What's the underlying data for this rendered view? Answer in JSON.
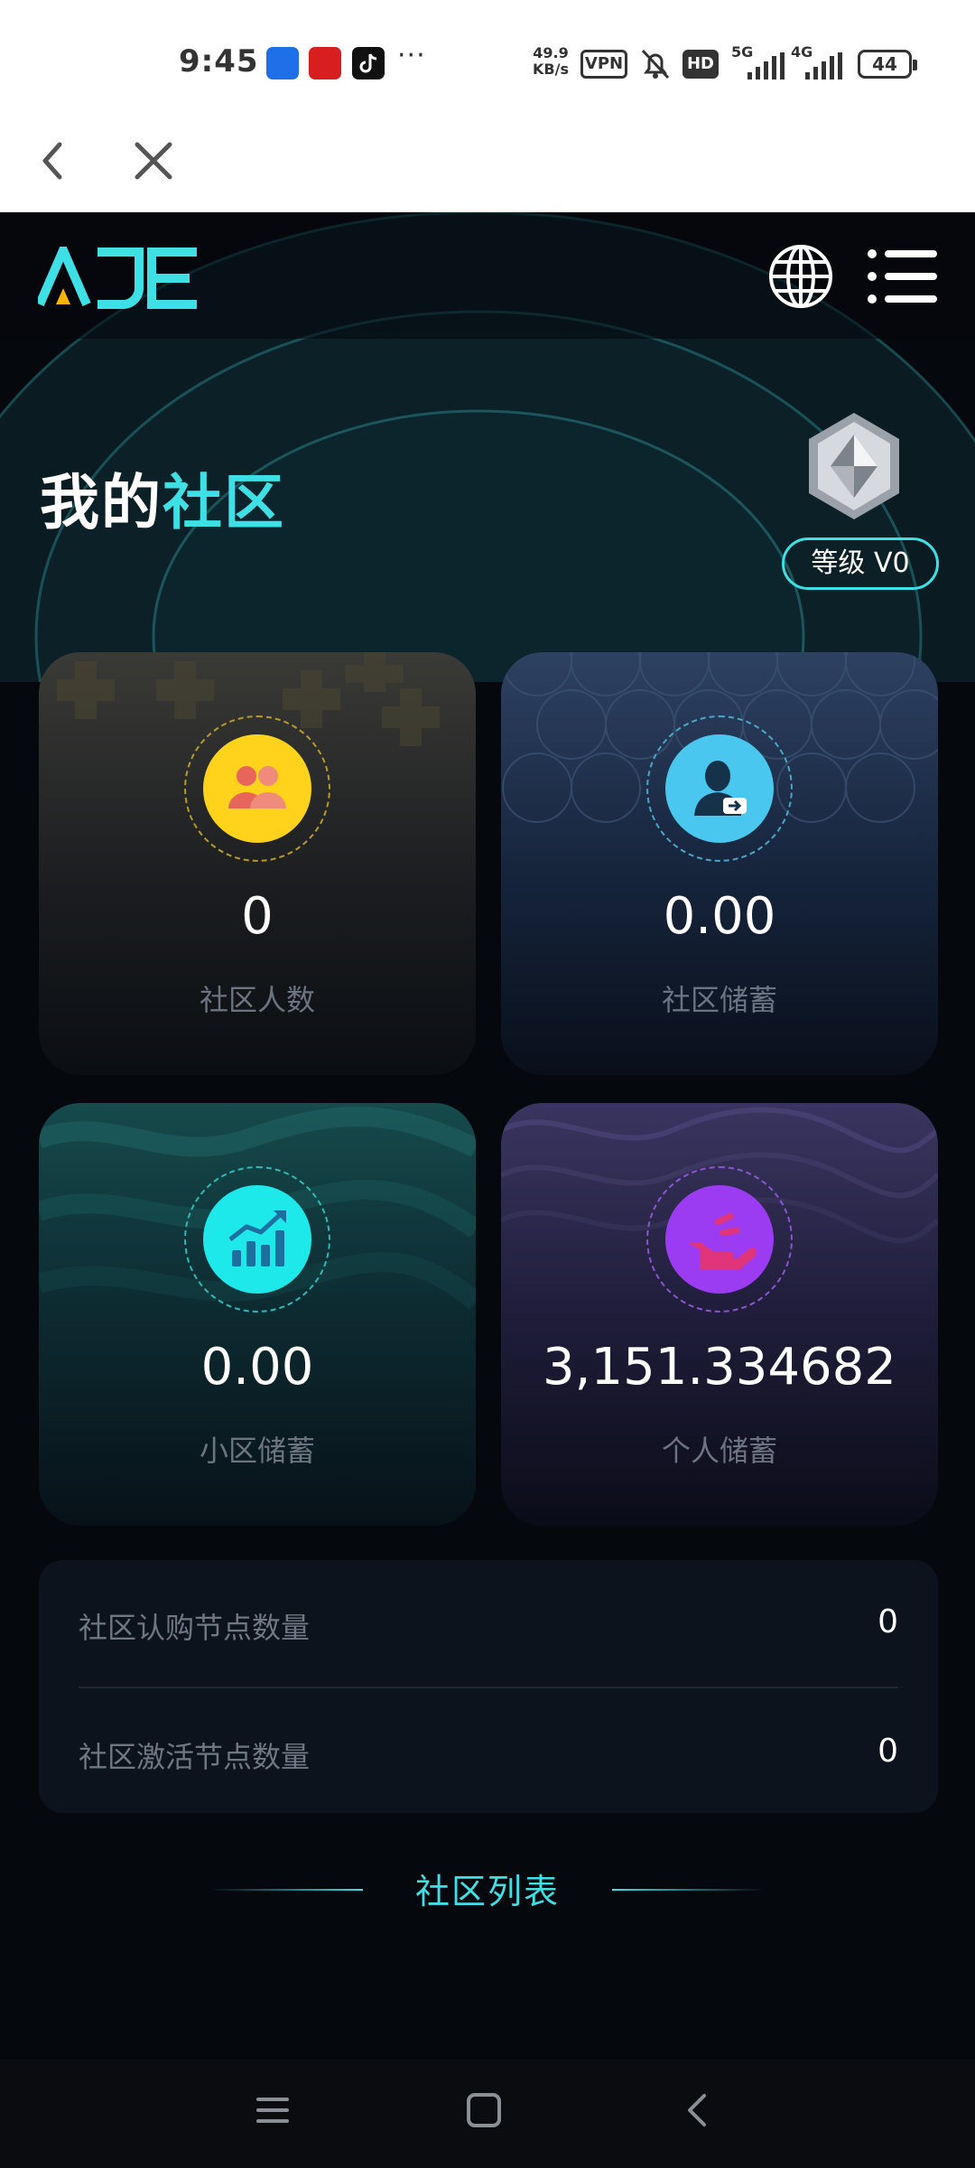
{
  "status_bar": {
    "time": "9:45",
    "more": "···",
    "speed_value": "49.9",
    "speed_unit": "KB/s",
    "vpn": "VPN",
    "hd": "HD",
    "net1": "5G",
    "net2": "4G",
    "battery": "44"
  },
  "browser": {
    "back_icon": "chevron-left-icon",
    "close_icon": "close-icon"
  },
  "header": {
    "logo": "AJE",
    "globe_icon": "globe-icon",
    "menu_icon": "menu-list-icon"
  },
  "page": {
    "title_part1": "我的",
    "title_part2": "社区",
    "level": "等级 V0"
  },
  "cards": [
    {
      "value": "0",
      "label": "社区人数",
      "icon": "community-users-icon",
      "color": "#ffd21c"
    },
    {
      "value": "0.00",
      "label": "社区储蓄",
      "icon": "user-transfer-icon",
      "color": "#49c7ef"
    },
    {
      "value": "0.00",
      "label": "小区储蓄",
      "icon": "growth-chart-icon",
      "color": "#1de9ea"
    },
    {
      "value": "3,151.334682",
      "label": "个人储蓄",
      "icon": "hand-savings-icon",
      "color": "#9b3cf2"
    }
  ],
  "stats": [
    {
      "label": "社区认购节点数量",
      "value": "0"
    },
    {
      "label": "社区激活节点数量",
      "value": "0"
    }
  ],
  "list_title": "社区列表",
  "colors": {
    "accent": "#3ee0e6",
    "background": "#05080d"
  }
}
